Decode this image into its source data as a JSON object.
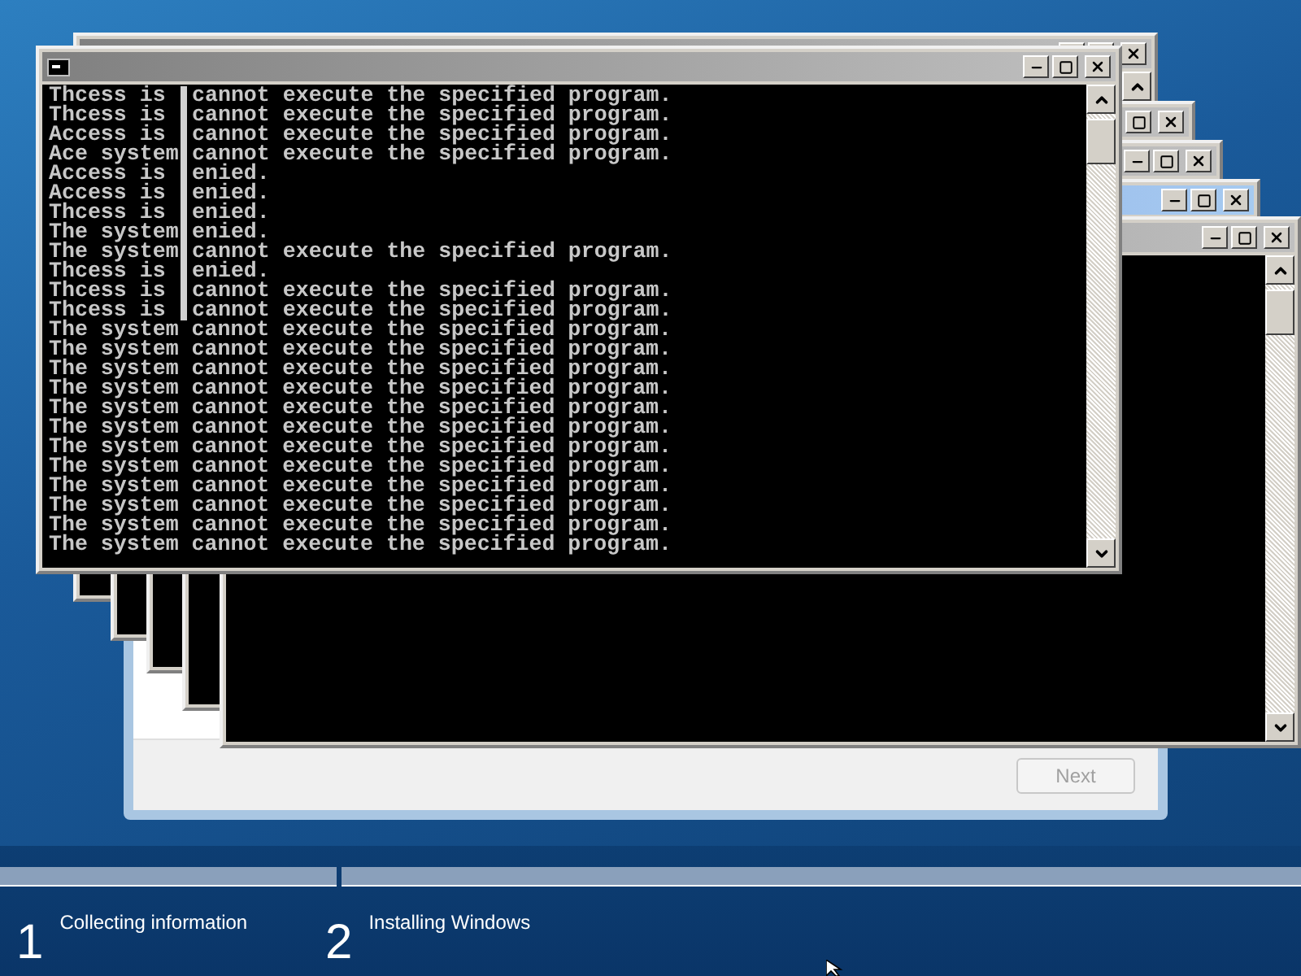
{
  "setup": {
    "next_button": {
      "label": "Next",
      "disabled": true
    }
  },
  "console": {
    "lines": [
      {
        "left": "Thcess is",
        "right": "cannot execute the specified program."
      },
      {
        "left": "Thcess is",
        "right": "cannot execute the specified program."
      },
      {
        "left": "Access is",
        "right": "cannot execute the specified program."
      },
      {
        "left": "Ace system",
        "right": "cannot execute the specified program."
      },
      {
        "left": "Access is",
        "right": "enied."
      },
      {
        "left": "Access is",
        "right": "enied."
      },
      {
        "left": "Thcess is",
        "right": "enied."
      },
      {
        "left": "The system",
        "right": "enied."
      },
      {
        "left": "The system",
        "right": "cannot execute the specified program."
      },
      {
        "left": "Thcess is",
        "right": "enied."
      },
      {
        "left": "Thcess is",
        "right": "cannot execute the specified program."
      },
      {
        "left": "Thcess is",
        "right": "cannot execute the specified program."
      },
      {
        "text": "The system cannot execute the specified program."
      },
      {
        "text": "The system cannot execute the specified program."
      },
      {
        "text": "The system cannot execute the specified program."
      },
      {
        "text": "The system cannot execute the specified program."
      },
      {
        "text": "The system cannot execute the specified program."
      },
      {
        "text": "The system cannot execute the specified program."
      },
      {
        "text": "The system cannot execute the specified program."
      },
      {
        "text": "The system cannot execute the specified program."
      },
      {
        "text": "The system cannot execute the specified program."
      },
      {
        "text": "The system cannot execute the specified program."
      },
      {
        "text": "The system cannot execute the specified program."
      },
      {
        "text": "The system cannot execute the specified program."
      }
    ]
  },
  "steps": [
    {
      "number": "1",
      "label": "Collecting information"
    },
    {
      "number": "2",
      "label": "Installing Windows"
    }
  ]
}
